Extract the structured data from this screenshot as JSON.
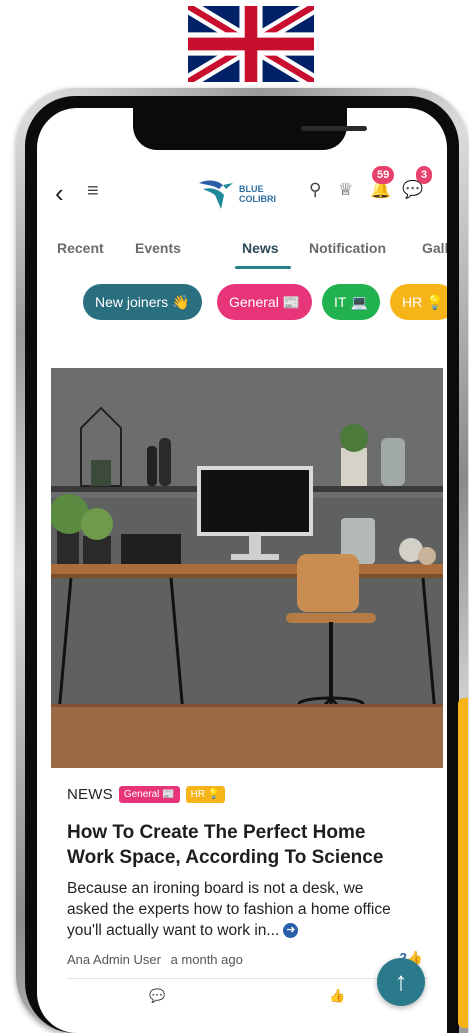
{
  "header": {
    "brand_line1": "BLUE",
    "brand_line2": "COLIBRI",
    "notifications_count": "59",
    "messages_count": "3"
  },
  "tabs": [
    {
      "label": "Recent"
    },
    {
      "label": "Events"
    },
    {
      "label": "News"
    },
    {
      "label": "Notification"
    },
    {
      "label": "Galle"
    }
  ],
  "active_tab": "News",
  "chips": [
    {
      "label": "New joiners",
      "emoji": "👋",
      "color": "#2a6f7f"
    },
    {
      "label": "General",
      "emoji": "📰",
      "color": "#e8357a"
    },
    {
      "label": "IT",
      "emoji": "💻",
      "color": "#21b14f"
    },
    {
      "label": "HR",
      "emoji": "💡",
      "color": "#f6b418"
    }
  ],
  "post": {
    "category": "NEWS",
    "tags": [
      {
        "label": "General",
        "emoji": "📰",
        "color": "#e8357a"
      },
      {
        "label": "HR",
        "emoji": "💡",
        "color": "#f6b418"
      }
    ],
    "title": "How To Create The Perfect Home Work Space, According To Science",
    "excerpt": "Because an ironing board is not a desk, we asked the experts how to fashion a home office you'll actually want to work in...",
    "author": "Ana Admin User",
    "time": "a month ago",
    "likes": "2"
  },
  "icons": {
    "back": "chevron-left-icon",
    "menu": "hamburger-icon",
    "search": "search-icon",
    "trophy": "trophy-icon",
    "bell": "bell-icon",
    "chat": "chat-icon",
    "comment": "comment-icon",
    "like": "thumbs-up-icon",
    "scroll_top": "arrow-up-icon"
  },
  "colors": {
    "accent": "#2a7a8c",
    "badge": "#e8416b",
    "link": "#2b5ea8"
  }
}
